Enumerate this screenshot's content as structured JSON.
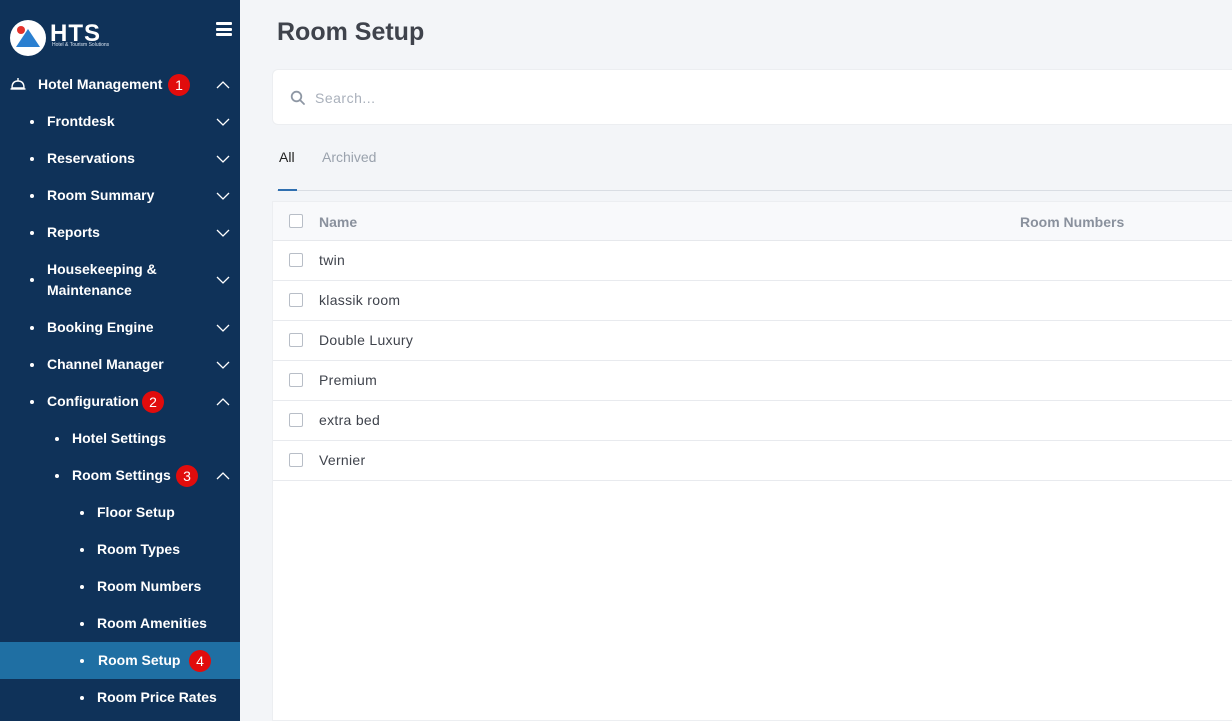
{
  "sidebar": {
    "brand": "HTS",
    "brand_sub": "Hotel & Tourism Solutions",
    "items": [
      {
        "label": "Hotel Management",
        "badge": "1"
      },
      {
        "label": "Frontdesk"
      },
      {
        "label": "Reservations"
      },
      {
        "label": "Room Summary"
      },
      {
        "label": "Reports"
      },
      {
        "label": "Housekeeping &",
        "label2": "Maintenance"
      },
      {
        "label": "Booking Engine"
      },
      {
        "label": "Channel Manager"
      },
      {
        "label": "Configuration",
        "badge": "2"
      },
      {
        "label": "Hotel Settings"
      },
      {
        "label": "Room Settings",
        "badge": "3"
      },
      {
        "label": "Floor Setup"
      },
      {
        "label": "Room Types"
      },
      {
        "label": "Room Numbers"
      },
      {
        "label": "Room Amenities"
      },
      {
        "label": "Room Setup",
        "badge": "4"
      },
      {
        "label": "Room Price Rates"
      }
    ]
  },
  "main": {
    "title": "Room Setup",
    "search_placeholder": "Search...",
    "tabs": [
      {
        "label": "All"
      },
      {
        "label": "Archived"
      }
    ],
    "table": {
      "headers": {
        "name": "Name",
        "room_numbers": "Room Numbers"
      },
      "rows": [
        "twin",
        "klassik room",
        "Double Luxury",
        "Premium",
        "extra bed",
        "Vernier"
      ]
    }
  },
  "colors": {
    "sidebar_bg": "#0f3259",
    "active_item": "#1f6fa3",
    "badge": "#e10c0c",
    "accent": "#2f6fb0"
  }
}
